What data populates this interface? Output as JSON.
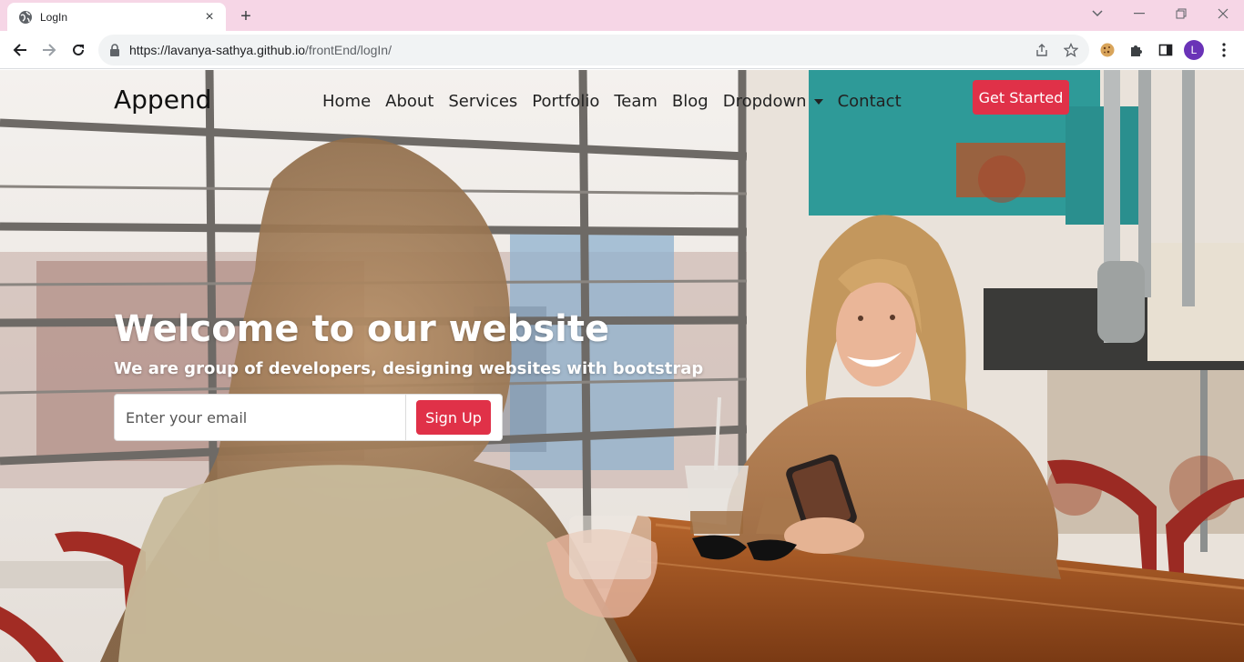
{
  "browser": {
    "tab_title": "LogIn",
    "url_host": "https://lavanya-sathya.github.io",
    "url_path": "/frontEnd/logIn/",
    "profile_initial": "L"
  },
  "site": {
    "brand": "Append",
    "nav": [
      "Home",
      "About",
      "Services",
      "Portfolio",
      "Team",
      "Blog",
      "Dropdown",
      "Contact"
    ],
    "cta_label": "Get Started",
    "accent_color": "#e03148"
  },
  "hero": {
    "title": "Welcome to our website",
    "subtitle": "We are group of developers, designing websites with bootstrap",
    "email_placeholder": "Enter your email",
    "signup_label": "Sign Up"
  }
}
